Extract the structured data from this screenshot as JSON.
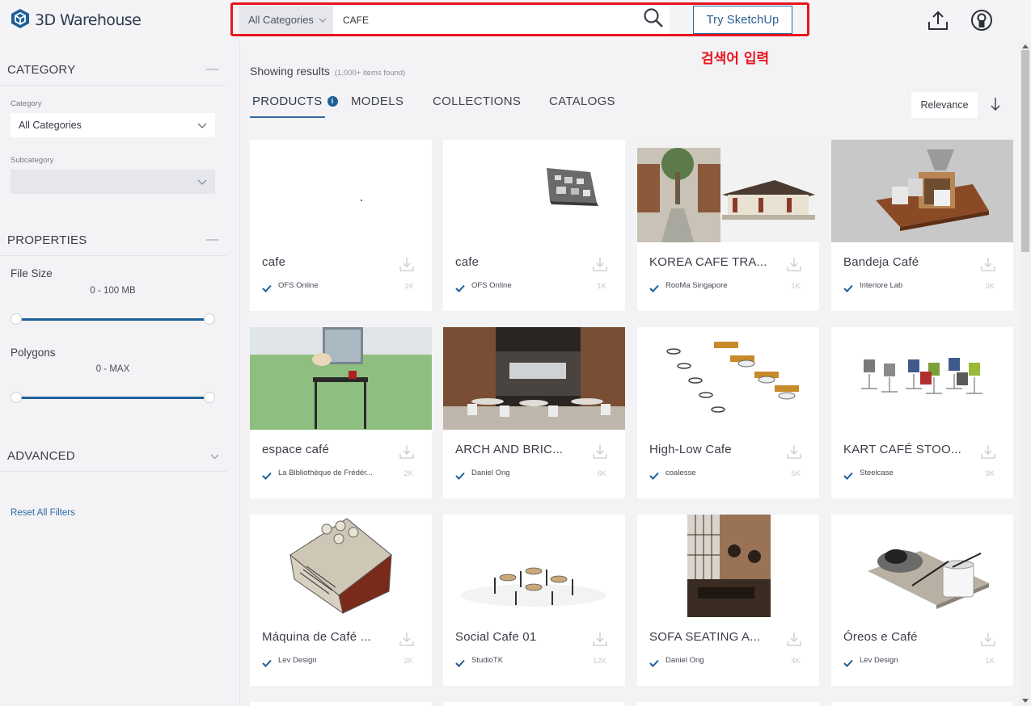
{
  "header": {
    "logo_text": "3D Warehouse",
    "search_category": "All Categories",
    "search_value": "CAFE",
    "try_label": "Try SketchUp",
    "annotation": "검색어 입력"
  },
  "sidebar": {
    "category_heading": "CATEGORY",
    "category_label": "Category",
    "category_value": "All Categories",
    "subcategory_label": "Subcategory",
    "subcategory_value": "",
    "properties_heading": "PROPERTIES",
    "file_size_label": "File Size",
    "file_size_range": "0 - 100 MB",
    "polygons_label": "Polygons",
    "polygons_range": "0 - MAX",
    "advanced_heading": "ADVANCED",
    "reset_label": "Reset All Filters"
  },
  "results": {
    "showing_label": "Showing results",
    "count_label": "(1,000+ items found)",
    "tabs": [
      "PRODUCTS",
      "MODELS",
      "COLLECTIONS",
      "CATALOGS"
    ],
    "sort_label": "Relevance"
  },
  "cards": [
    {
      "title": "cafe",
      "author": "OFS Online",
      "downloads": "16"
    },
    {
      "title": "cafe",
      "author": "OFS Online",
      "downloads": "1K"
    },
    {
      "title": "KOREA CAFE TRA...",
      "author": "RooMa Singapore",
      "downloads": "1K"
    },
    {
      "title": "Bandeja Café",
      "author": "Interiore Lab",
      "downloads": "3K"
    },
    {
      "title": "espace café",
      "author": "La Bibliothèque de Frédér...",
      "downloads": "2K"
    },
    {
      "title": "ARCH AND BRIC...",
      "author": "Daniel Ong",
      "downloads": "6K"
    },
    {
      "title": "High-Low Cafe",
      "author": "coalesse",
      "downloads": "5K"
    },
    {
      "title": "KART CAFÉ STOO...",
      "author": "Steelcase",
      "downloads": "3K"
    },
    {
      "title": "Máquina de Café ...",
      "author": "Lev Design",
      "downloads": "2K"
    },
    {
      "title": "Social Cafe 01",
      "author": "StudioTK",
      "downloads": "12K"
    },
    {
      "title": "SOFA SEATING A...",
      "author": "Daniel Ong",
      "downloads": "4K"
    },
    {
      "title": "Óreos e Café",
      "author": "Lev Design",
      "downloads": "1K"
    }
  ],
  "colors": {
    "accent": "#1f5f98",
    "highlight": "#e8141e"
  }
}
